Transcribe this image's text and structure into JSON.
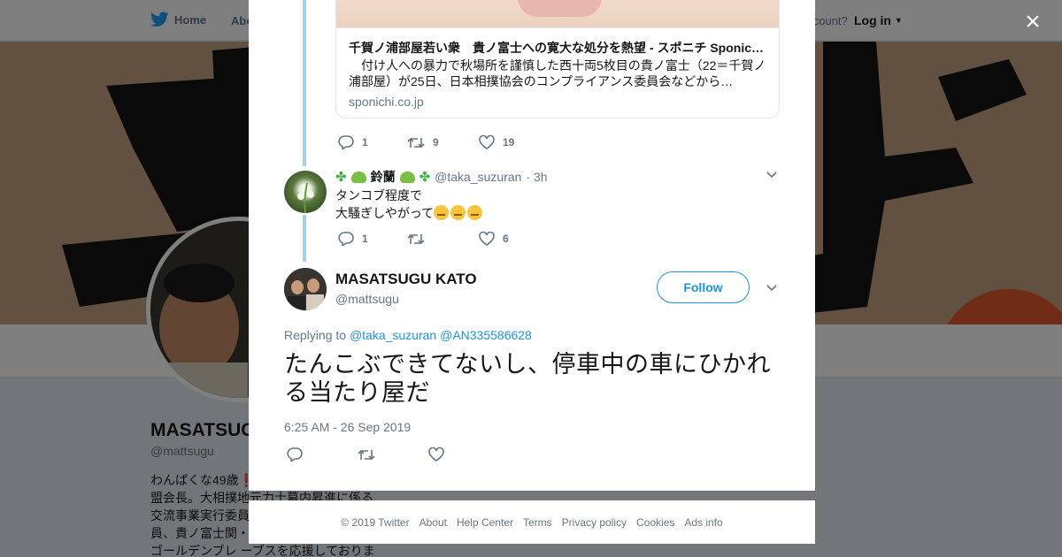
{
  "background": {
    "nav": {
      "home": "Home",
      "about": "Abo",
      "account": "account?",
      "login": "Log in"
    },
    "profile": {
      "name": "MASATSUG",
      "handle": "@mattsugu",
      "bio_lines": [
        "わんぱくな49歳❗",
        "盟会長。大相撲地元力士幕内昇進に係る",
        "交流事業実行委員",
        "員、貴ノ富士関・",
        "ゴールデンブレ ーブスを応援しておりま"
      ]
    }
  },
  "modal": {
    "close_label": "×",
    "link_card": {
      "title": "千賀ノ浦部屋若い衆　貴ノ富士への寛大な処分を熱望 - スポニチ Sponichi Annex 社会",
      "description": "　付け人への暴力で秋場所を謹慎した西十両5枚目の貴ノ富士（22＝千賀ノ浦部屋）が25日、日本相撲協会のコンプライアンス委員会などから…",
      "domain": "sponichi.co.jp"
    },
    "first_tweet_actions": {
      "replies": "1",
      "retweets": "9",
      "likes": "19"
    },
    "reply_tweet": {
      "name": "鈴蘭",
      "handle": "@taka_suzuran",
      "time": "· 3h",
      "line1": "タンコブ程度で",
      "line2": "大騒ぎしやがって",
      "actions": {
        "replies": "1",
        "retweets": "",
        "likes": "6"
      }
    },
    "main_tweet": {
      "name": "MASATSUGU KATO",
      "handle": "@mattsugu",
      "follow_label": "Follow",
      "replying_prefix": "Replying to",
      "replying_to_1": "@taka_suzuran",
      "replying_to_2": "@AN335586628",
      "text": "たんこぶできてないし、停車中の車にひかれる当たり屋だ",
      "timestamp": "6:25 AM - 26 Sep 2019"
    }
  },
  "footer": {
    "copyright": "© 2019 Twitter",
    "about": "About",
    "help": "Help Center",
    "terms": "Terms",
    "privacy": "Privacy policy",
    "cookies": "Cookies",
    "ads": "Ads info"
  },
  "colors": {
    "twitter_blue": "#1b95e0",
    "thread_line": "#a6cfe8",
    "secondary_text": "#657786"
  }
}
